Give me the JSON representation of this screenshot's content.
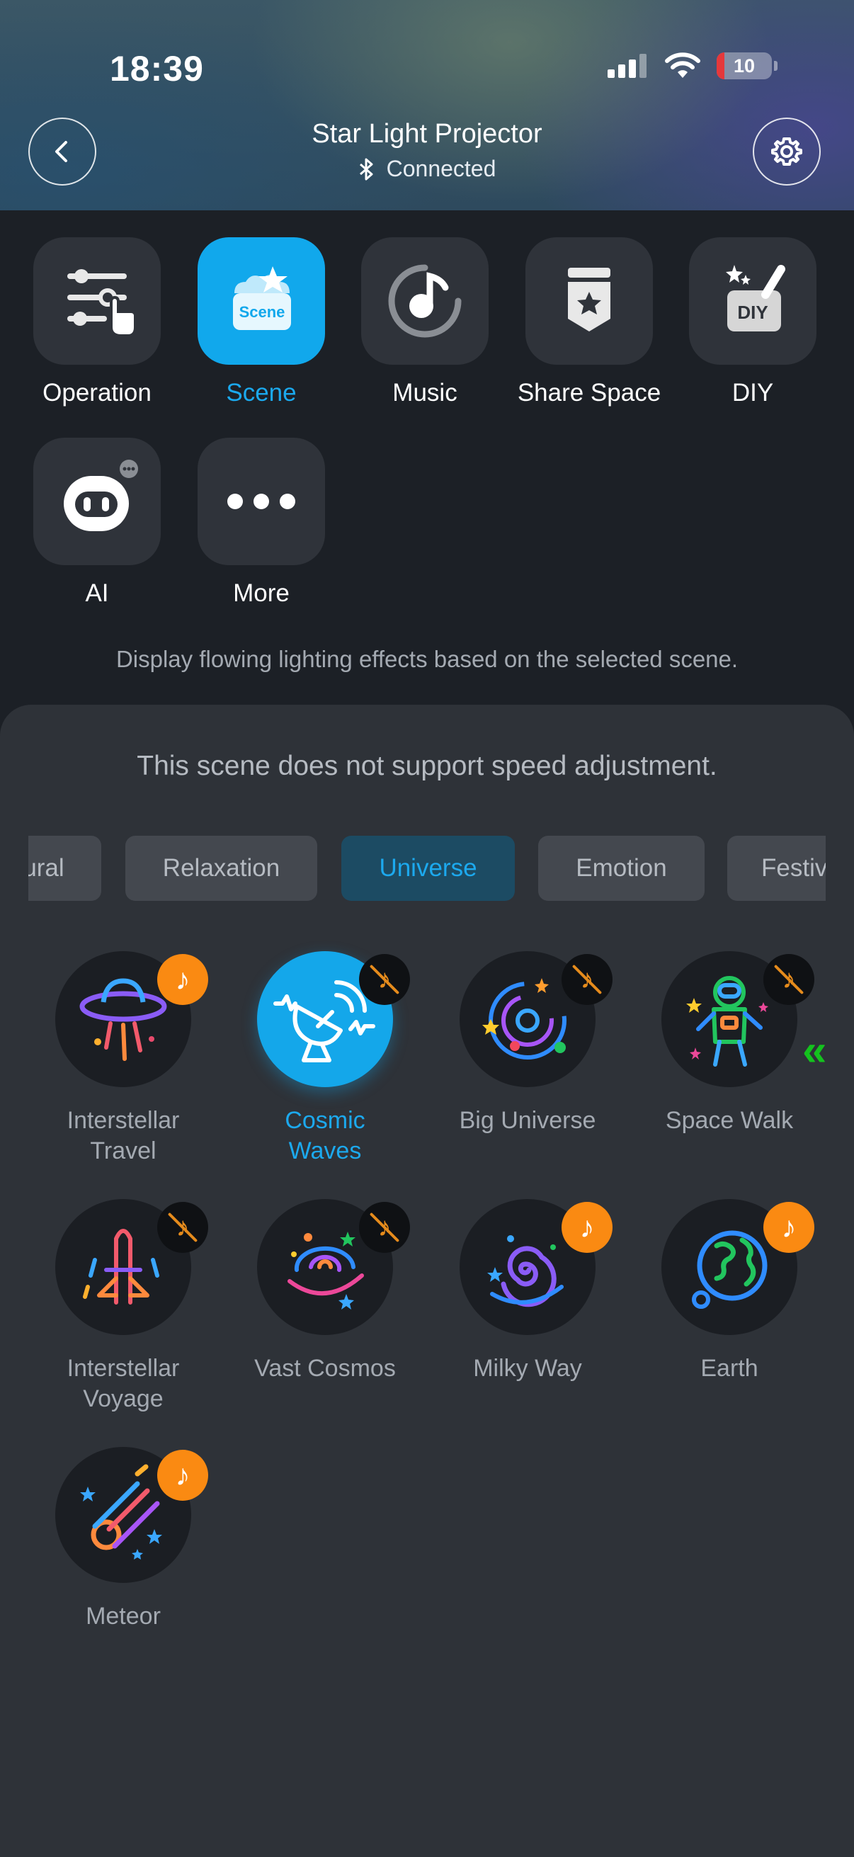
{
  "status_bar": {
    "time": "18:39",
    "battery": "10"
  },
  "header": {
    "title": "Star Light Projector",
    "status": "Connected"
  },
  "modes": [
    {
      "label": "Operation",
      "icon": "sliders-touch-icon",
      "active": false
    },
    {
      "label": "Scene",
      "icon": "scene-icon",
      "badge_text": "Scene",
      "active": true
    },
    {
      "label": "Music",
      "icon": "music-disc-icon",
      "active": false
    },
    {
      "label": "Share Space",
      "icon": "share-space-icon",
      "active": false
    },
    {
      "label": "DIY",
      "icon": "diy-icon",
      "badge_text": "DIY",
      "active": false
    },
    {
      "label": "AI",
      "icon": "ai-robot-icon",
      "active": false
    },
    {
      "label": "More",
      "icon": "more-dots-icon",
      "active": false
    }
  ],
  "description": "Display flowing lighting effects based on the selected scene.",
  "sheet": {
    "speed_note": "This scene does not support speed adjustment.",
    "tabs": [
      {
        "label": "ural",
        "active": false
      },
      {
        "label": "Relaxation",
        "active": false
      },
      {
        "label": "Universe",
        "active": true
      },
      {
        "label": "Emotion",
        "active": false
      },
      {
        "label": "Festiv",
        "active": false
      }
    ],
    "scenes": [
      {
        "line1": "Interstellar",
        "line2": "Travel",
        "music": true,
        "active": false,
        "icon": "ufo-icon"
      },
      {
        "line1": "Cosmic",
        "line2": "Waves",
        "music": false,
        "active": true,
        "icon": "satellite-dish-icon"
      },
      {
        "line1": "Big Universe",
        "line2": "",
        "music": false,
        "active": false,
        "icon": "orbit-icon"
      },
      {
        "line1": "Space Walk",
        "line2": "",
        "music": false,
        "active": false,
        "icon": "astronaut-icon"
      },
      {
        "line1": "Interstellar",
        "line2": "Voyage",
        "music": false,
        "active": false,
        "icon": "rocket-icon"
      },
      {
        "line1": "Vast Cosmos",
        "line2": "",
        "music": false,
        "active": false,
        "icon": "galaxy-icon"
      },
      {
        "line1": "Milky Way",
        "line2": "",
        "music": true,
        "active": false,
        "icon": "spiral-galaxy-icon"
      },
      {
        "line1": "Earth",
        "line2": "",
        "music": true,
        "active": false,
        "icon": "earth-icon"
      },
      {
        "line1": "Meteor",
        "line2": "",
        "music": true,
        "active": false,
        "icon": "meteor-icon"
      }
    ]
  },
  "swipe_hint": "«",
  "colors": {
    "accent": "#11a8ec",
    "music_badge": "#fa8a12",
    "hint": "#14c21e"
  }
}
